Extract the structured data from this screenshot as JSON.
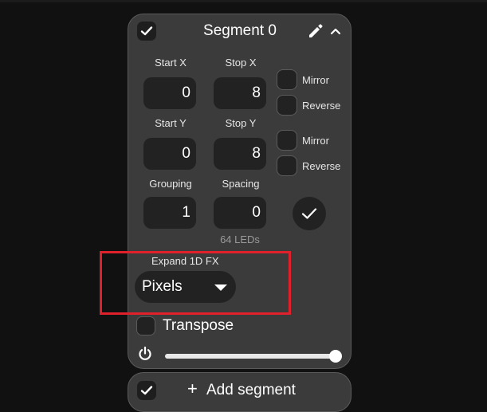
{
  "segment": {
    "title": "Segment 0",
    "fields": {
      "start_x": {
        "label": "Start X",
        "value": "0"
      },
      "stop_x": {
        "label": "Stop X",
        "value": "8"
      },
      "start_y": {
        "label": "Start Y",
        "value": "0"
      },
      "stop_y": {
        "label": "Stop Y",
        "value": "8"
      },
      "grouping": {
        "label": "Grouping",
        "value": "1"
      },
      "spacing": {
        "label": "Spacing",
        "value": "0"
      }
    },
    "x_options": {
      "mirror_label": "Mirror",
      "reverse_label": "Reverse"
    },
    "y_options": {
      "mirror_label": "Mirror",
      "reverse_label": "Reverse"
    },
    "led_count": "64 LEDs",
    "expand": {
      "label": "Expand 1D FX",
      "selected": "Pixels"
    },
    "transpose_label": "Transpose",
    "brightness_fraction": 1.0,
    "icons": [
      "check-icon",
      "pencil-icon",
      "chevron-up-icon",
      "power-icon",
      "plus-icon"
    ]
  },
  "add_segment": {
    "plus": "+",
    "label": "Add segment"
  },
  "colors": {
    "card": "#3b3b3b",
    "input": "#222222",
    "highlight": "#e0202b",
    "page": "#111111"
  }
}
